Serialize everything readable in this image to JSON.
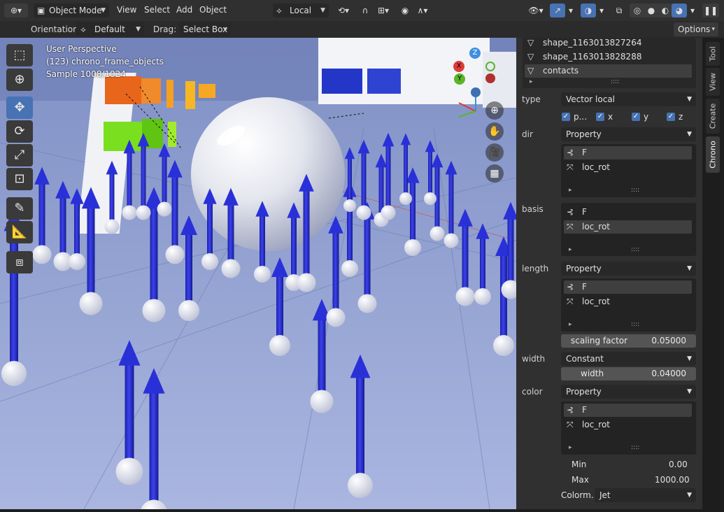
{
  "header": {
    "mode": "Object Mode",
    "menus": [
      "View",
      "Select",
      "Add",
      "Object"
    ],
    "transform_orientation": "Local",
    "options_label": "Options"
  },
  "toolheader": {
    "orientation_label": "Orientation:",
    "orientation_value": "Default",
    "drag_label": "Drag:",
    "drag_value": "Select Box"
  },
  "viewport": {
    "perspective": "User Perspective",
    "collection": "(123) chrono_frame_objects",
    "sample": "Sample 1008/1024",
    "gizmo": {
      "z": "Z",
      "x": "X",
      "y": "Y"
    }
  },
  "panel": {
    "objects": [
      {
        "label": "shape_1163013827264",
        "selected": false
      },
      {
        "label": "shape_1163013828288",
        "selected": false
      },
      {
        "label": "contacts",
        "selected": true
      }
    ],
    "type_label": "type",
    "type_value": "Vector local",
    "checks": [
      {
        "label": "p...",
        "checked": true
      },
      {
        "label": "x",
        "checked": true
      },
      {
        "label": "y",
        "checked": true
      },
      {
        "label": "z",
        "checked": true
      }
    ],
    "dir_label": "dir",
    "dir_value": "Property",
    "dir_items": [
      {
        "label": "F",
        "selected": true
      },
      {
        "label": "loc_rot",
        "selected": false
      }
    ],
    "basis_label": "basis",
    "basis_items": [
      {
        "label": "F",
        "selected": false
      },
      {
        "label": "loc_rot",
        "selected": true
      }
    ],
    "length_label": "length",
    "length_value": "Property",
    "length_items": [
      {
        "label": "F",
        "selected": true
      },
      {
        "label": "loc_rot",
        "selected": false
      }
    ],
    "scaling_label": "scaling factor",
    "scaling_value": "0.05000",
    "width_label": "width",
    "width_value": "Constant",
    "width_field_label": "width",
    "width_field_value": "0.04000",
    "color_label": "color",
    "color_value": "Property",
    "color_items": [
      {
        "label": "F",
        "selected": true
      },
      {
        "label": "loc_rot",
        "selected": false
      }
    ],
    "min_label": "Min",
    "min_value": "0.00",
    "max_label": "Max",
    "max_value": "1000.00",
    "colormap_label": "Colorm...",
    "colormap_value": "Jet"
  },
  "tabs": [
    "Tool",
    "View",
    "Create",
    "Chrono"
  ],
  "colors": {
    "accent": "#4772b3",
    "panel": "#303030",
    "arrow": "#2a2fd6"
  }
}
